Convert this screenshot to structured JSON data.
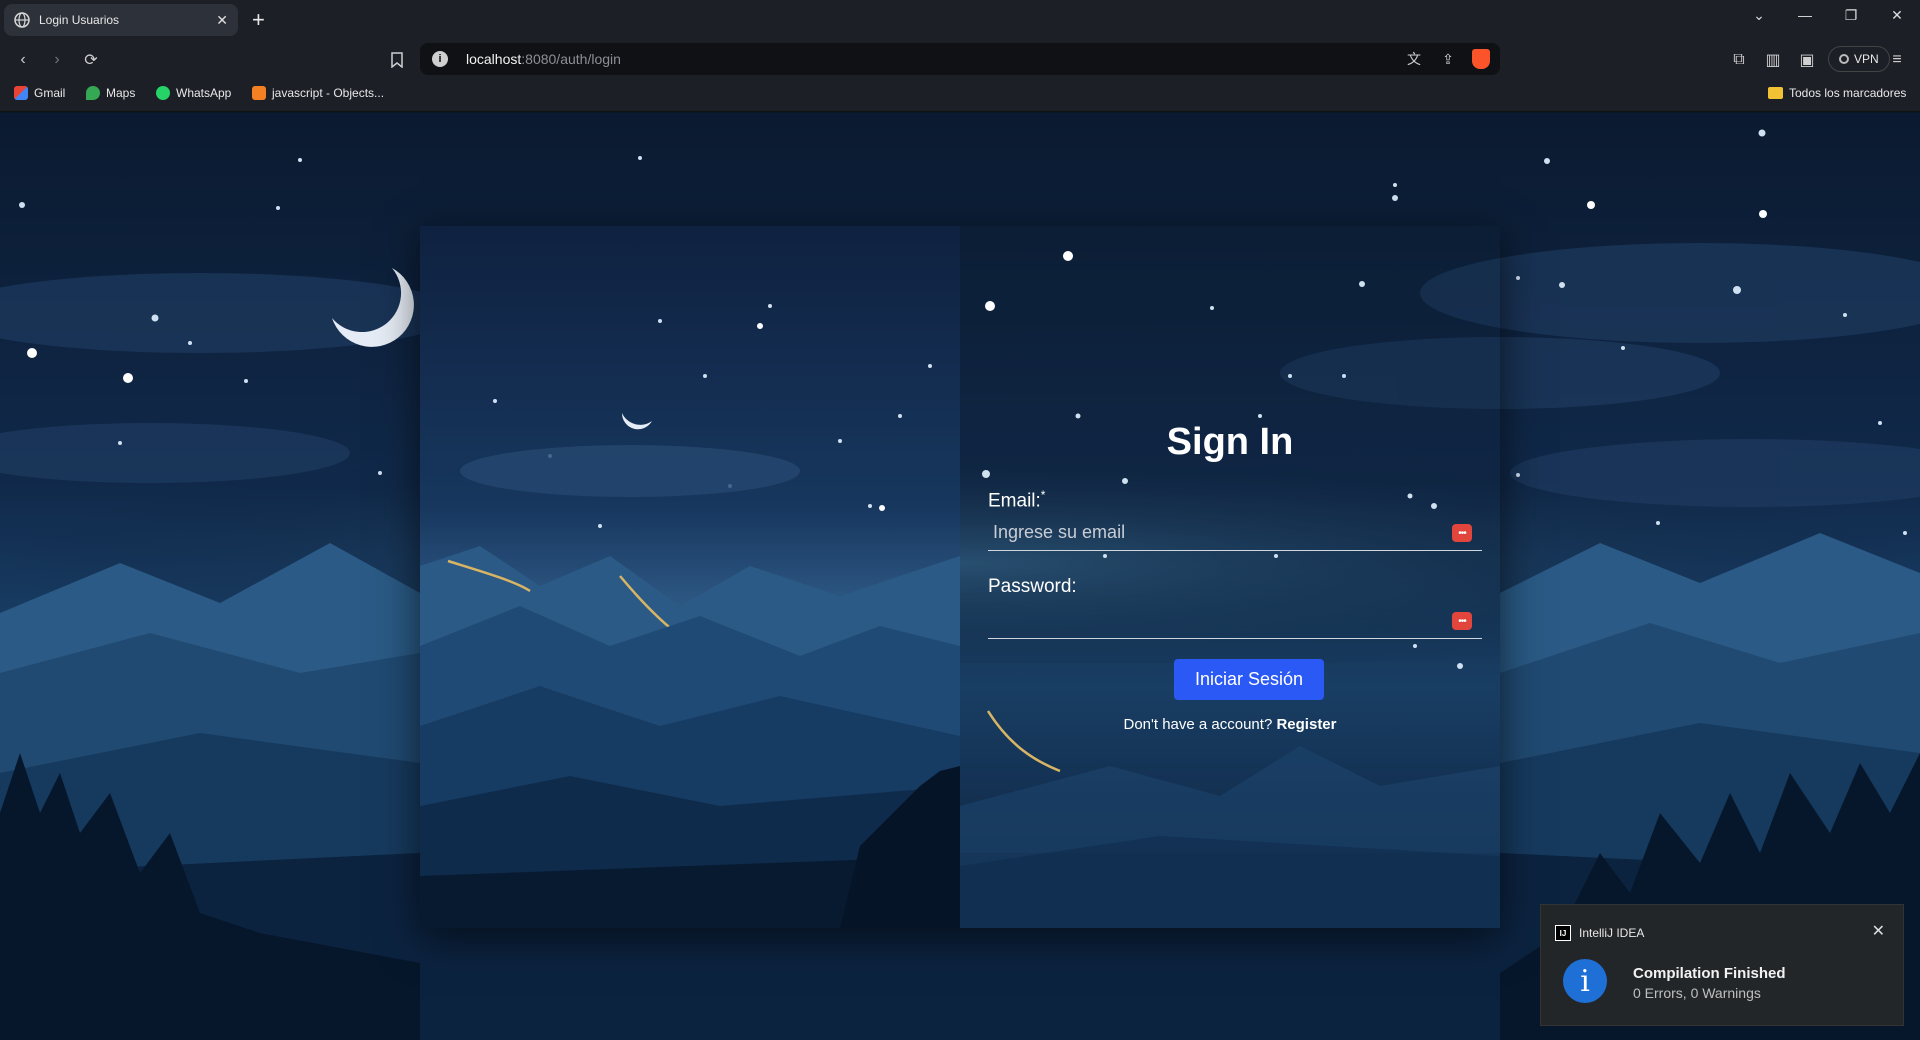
{
  "browser": {
    "tab_title": "Login Usuarios",
    "url_host": "localhost",
    "url_path": ":8080/auth/login",
    "vpn_label": "VPN",
    "bookmarks": [
      "Gmail",
      "Maps",
      "WhatsApp",
      "javascript - Objects..."
    ],
    "bookmarks_folder": "Todos los marcadores"
  },
  "login": {
    "title": "Sign In",
    "email_label": "Email:",
    "email_required_mark": "*",
    "email_placeholder": "Ingrese su email",
    "password_label": "Password:",
    "submit_label": "Iniciar Sesión",
    "register_prompt": "Don't have a account?",
    "register_link": "Register"
  },
  "notification": {
    "app_name": "IntelliJ IDEA",
    "app_icon_text": "IJ",
    "title": "Compilation Finished",
    "message": "0 Errors, 0 Warnings"
  },
  "colors": {
    "submit_button": "#2b59f5",
    "brave_accent": "#fb542b",
    "password_manager_icon": "#e2453c"
  }
}
